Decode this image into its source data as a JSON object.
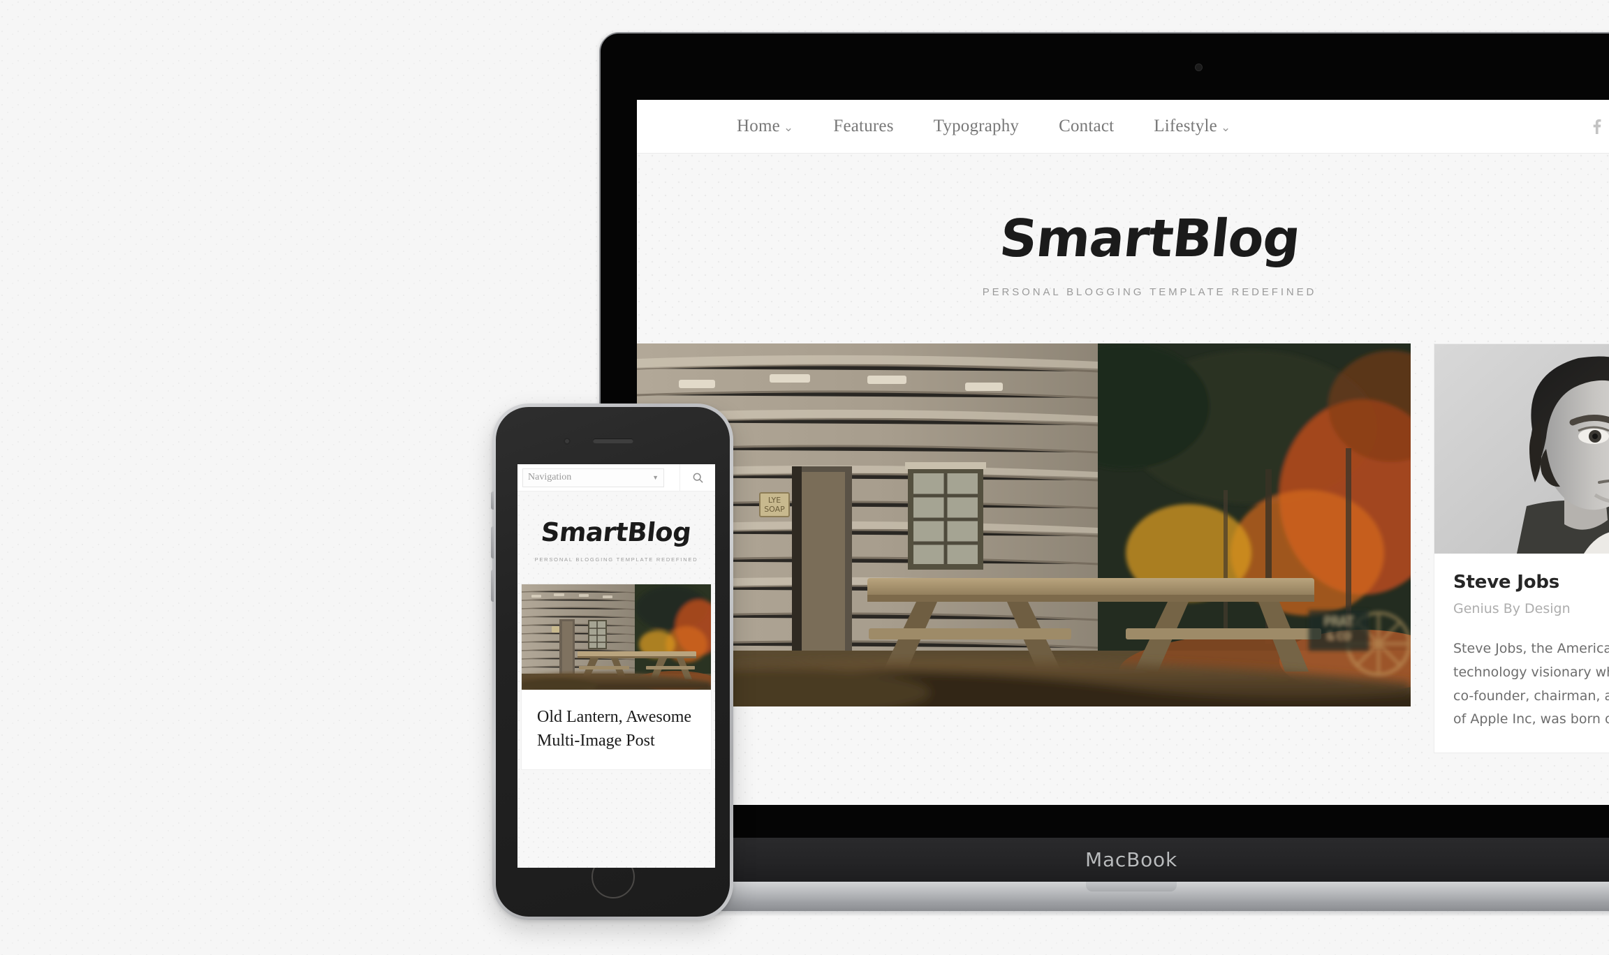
{
  "device_labels": {
    "macbook": "MacBook"
  },
  "desktop_site": {
    "nav": [
      {
        "label": "Home",
        "has_caret": true,
        "caret": "⌄"
      },
      {
        "label": "Features",
        "has_caret": false,
        "caret": ""
      },
      {
        "label": "Typography",
        "has_caret": false,
        "caret": ""
      },
      {
        "label": "Contact",
        "has_caret": false,
        "caret": ""
      },
      {
        "label": "Lifestyle",
        "has_caret": true,
        "caret": "⌄"
      }
    ],
    "social": [
      {
        "name": "facebook-icon"
      },
      {
        "name": "twitter-icon"
      }
    ],
    "brand": {
      "logo": "SmartBlog",
      "tagline": "PERSONAL BLOGGING TEMPLATE REDEFINED"
    },
    "hero_post": {
      "image_alt": "log cabin with picnic table in autumn"
    },
    "side_card": {
      "title": "Steve Jobs",
      "subtitle": "Genius By Design",
      "photo_alt": "black and white portrait of young Steve Jobs",
      "body_lines": [
        "Steve Jobs, the American b",
        "technology visionary who",
        "co-founder, chairman, and",
        "of Apple Inc, was born on"
      ]
    }
  },
  "mobile_site": {
    "nav_select": {
      "value": "Navigation",
      "caret": "▼"
    },
    "search_icon": "search-icon",
    "brand": {
      "logo": "SmartBlog",
      "tagline": "PERSONAL BLOGGING TEMPLATE REDEFINED"
    },
    "post": {
      "title": "Old Lantern, Awesome Multi-Image Post",
      "image_alt": "log cabin with picnic table in autumn"
    }
  },
  "colors": {
    "page_bg": "#f6f6f6",
    "site_bg": "#f7f7f7",
    "nav_text": "#787878",
    "heading": "#262626",
    "muted": "#adadad",
    "body_text": "#6d6d6d",
    "bezel": "#050505",
    "chin": "#242426",
    "base_silver": "#b6b8bb"
  }
}
